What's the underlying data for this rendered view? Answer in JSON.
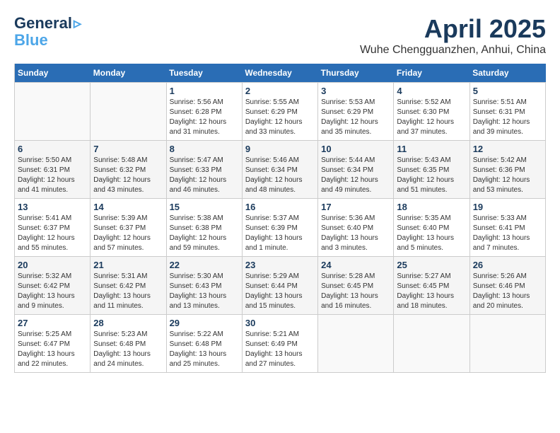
{
  "header": {
    "logo_line1": "General",
    "logo_line2": "Blue",
    "month_year": "April 2025",
    "location": "Wuhe Chengguanzhen, Anhui, China"
  },
  "weekdays": [
    "Sunday",
    "Monday",
    "Tuesday",
    "Wednesday",
    "Thursday",
    "Friday",
    "Saturday"
  ],
  "weeks": [
    [
      {
        "day": "",
        "sunrise": "",
        "sunset": "",
        "daylight": ""
      },
      {
        "day": "",
        "sunrise": "",
        "sunset": "",
        "daylight": ""
      },
      {
        "day": "1",
        "sunrise": "Sunrise: 5:56 AM",
        "sunset": "Sunset: 6:28 PM",
        "daylight": "Daylight: 12 hours and 31 minutes."
      },
      {
        "day": "2",
        "sunrise": "Sunrise: 5:55 AM",
        "sunset": "Sunset: 6:29 PM",
        "daylight": "Daylight: 12 hours and 33 minutes."
      },
      {
        "day": "3",
        "sunrise": "Sunrise: 5:53 AM",
        "sunset": "Sunset: 6:29 PM",
        "daylight": "Daylight: 12 hours and 35 minutes."
      },
      {
        "day": "4",
        "sunrise": "Sunrise: 5:52 AM",
        "sunset": "Sunset: 6:30 PM",
        "daylight": "Daylight: 12 hours and 37 minutes."
      },
      {
        "day": "5",
        "sunrise": "Sunrise: 5:51 AM",
        "sunset": "Sunset: 6:31 PM",
        "daylight": "Daylight: 12 hours and 39 minutes."
      }
    ],
    [
      {
        "day": "6",
        "sunrise": "Sunrise: 5:50 AM",
        "sunset": "Sunset: 6:31 PM",
        "daylight": "Daylight: 12 hours and 41 minutes."
      },
      {
        "day": "7",
        "sunrise": "Sunrise: 5:48 AM",
        "sunset": "Sunset: 6:32 PM",
        "daylight": "Daylight: 12 hours and 43 minutes."
      },
      {
        "day": "8",
        "sunrise": "Sunrise: 5:47 AM",
        "sunset": "Sunset: 6:33 PM",
        "daylight": "Daylight: 12 hours and 46 minutes."
      },
      {
        "day": "9",
        "sunrise": "Sunrise: 5:46 AM",
        "sunset": "Sunset: 6:34 PM",
        "daylight": "Daylight: 12 hours and 48 minutes."
      },
      {
        "day": "10",
        "sunrise": "Sunrise: 5:44 AM",
        "sunset": "Sunset: 6:34 PM",
        "daylight": "Daylight: 12 hours and 49 minutes."
      },
      {
        "day": "11",
        "sunrise": "Sunrise: 5:43 AM",
        "sunset": "Sunset: 6:35 PM",
        "daylight": "Daylight: 12 hours and 51 minutes."
      },
      {
        "day": "12",
        "sunrise": "Sunrise: 5:42 AM",
        "sunset": "Sunset: 6:36 PM",
        "daylight": "Daylight: 12 hours and 53 minutes."
      }
    ],
    [
      {
        "day": "13",
        "sunrise": "Sunrise: 5:41 AM",
        "sunset": "Sunset: 6:37 PM",
        "daylight": "Daylight: 12 hours and 55 minutes."
      },
      {
        "day": "14",
        "sunrise": "Sunrise: 5:39 AM",
        "sunset": "Sunset: 6:37 PM",
        "daylight": "Daylight: 12 hours and 57 minutes."
      },
      {
        "day": "15",
        "sunrise": "Sunrise: 5:38 AM",
        "sunset": "Sunset: 6:38 PM",
        "daylight": "Daylight: 12 hours and 59 minutes."
      },
      {
        "day": "16",
        "sunrise": "Sunrise: 5:37 AM",
        "sunset": "Sunset: 6:39 PM",
        "daylight": "Daylight: 13 hours and 1 minute."
      },
      {
        "day": "17",
        "sunrise": "Sunrise: 5:36 AM",
        "sunset": "Sunset: 6:40 PM",
        "daylight": "Daylight: 13 hours and 3 minutes."
      },
      {
        "day": "18",
        "sunrise": "Sunrise: 5:35 AM",
        "sunset": "Sunset: 6:40 PM",
        "daylight": "Daylight: 13 hours and 5 minutes."
      },
      {
        "day": "19",
        "sunrise": "Sunrise: 5:33 AM",
        "sunset": "Sunset: 6:41 PM",
        "daylight": "Daylight: 13 hours and 7 minutes."
      }
    ],
    [
      {
        "day": "20",
        "sunrise": "Sunrise: 5:32 AM",
        "sunset": "Sunset: 6:42 PM",
        "daylight": "Daylight: 13 hours and 9 minutes."
      },
      {
        "day": "21",
        "sunrise": "Sunrise: 5:31 AM",
        "sunset": "Sunset: 6:42 PM",
        "daylight": "Daylight: 13 hours and 11 minutes."
      },
      {
        "day": "22",
        "sunrise": "Sunrise: 5:30 AM",
        "sunset": "Sunset: 6:43 PM",
        "daylight": "Daylight: 13 hours and 13 minutes."
      },
      {
        "day": "23",
        "sunrise": "Sunrise: 5:29 AM",
        "sunset": "Sunset: 6:44 PM",
        "daylight": "Daylight: 13 hours and 15 minutes."
      },
      {
        "day": "24",
        "sunrise": "Sunrise: 5:28 AM",
        "sunset": "Sunset: 6:45 PM",
        "daylight": "Daylight: 13 hours and 16 minutes."
      },
      {
        "day": "25",
        "sunrise": "Sunrise: 5:27 AM",
        "sunset": "Sunset: 6:45 PM",
        "daylight": "Daylight: 13 hours and 18 minutes."
      },
      {
        "day": "26",
        "sunrise": "Sunrise: 5:26 AM",
        "sunset": "Sunset: 6:46 PM",
        "daylight": "Daylight: 13 hours and 20 minutes."
      }
    ],
    [
      {
        "day": "27",
        "sunrise": "Sunrise: 5:25 AM",
        "sunset": "Sunset: 6:47 PM",
        "daylight": "Daylight: 13 hours and 22 minutes."
      },
      {
        "day": "28",
        "sunrise": "Sunrise: 5:23 AM",
        "sunset": "Sunset: 6:48 PM",
        "daylight": "Daylight: 13 hours and 24 minutes."
      },
      {
        "day": "29",
        "sunrise": "Sunrise: 5:22 AM",
        "sunset": "Sunset: 6:48 PM",
        "daylight": "Daylight: 13 hours and 25 minutes."
      },
      {
        "day": "30",
        "sunrise": "Sunrise: 5:21 AM",
        "sunset": "Sunset: 6:49 PM",
        "daylight": "Daylight: 13 hours and 27 minutes."
      },
      {
        "day": "",
        "sunrise": "",
        "sunset": "",
        "daylight": ""
      },
      {
        "day": "",
        "sunrise": "",
        "sunset": "",
        "daylight": ""
      },
      {
        "day": "",
        "sunrise": "",
        "sunset": "",
        "daylight": ""
      }
    ]
  ]
}
